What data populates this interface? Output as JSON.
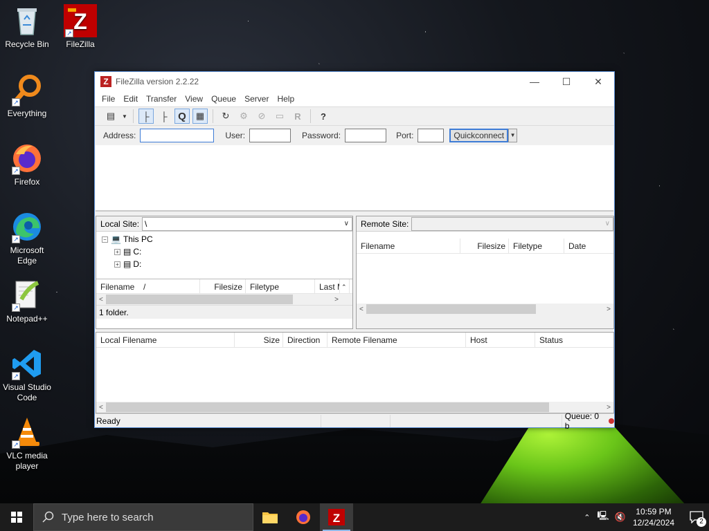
{
  "desktop": {
    "icons": [
      {
        "label": "Recycle Bin"
      },
      {
        "label": "FileZilla"
      },
      {
        "label": "Everything"
      },
      {
        "label": "Firefox"
      },
      {
        "label": "Microsoft Edge"
      },
      {
        "label": "Notepad++"
      },
      {
        "label": "Visual Studio Code"
      },
      {
        "label": "VLC media player"
      }
    ]
  },
  "window": {
    "title": "FileZilla version 2.2.22",
    "menu": [
      "File",
      "Edit",
      "Transfer",
      "View",
      "Queue",
      "Server",
      "Help"
    ],
    "quickconnect": {
      "address_label": "Address:",
      "user_label": "User:",
      "password_label": "Password:",
      "port_label": "Port:",
      "button_label": "Quickconnect",
      "address_value": "",
      "user_value": "",
      "password_value": "",
      "port_value": ""
    },
    "local": {
      "site_label": "Local Site:",
      "path": "\\",
      "tree": [
        {
          "label": "This PC"
        },
        {
          "label": "C:"
        },
        {
          "label": "D:"
        }
      ],
      "columns": [
        "Filename",
        "/",
        "Filesize",
        "Filetype",
        "Last M"
      ],
      "status": "1 folder."
    },
    "remote": {
      "site_label": "Remote Site:",
      "path": "",
      "columns": [
        "Filename",
        "Filesize",
        "Filetype",
        "Date"
      ]
    },
    "queue": {
      "columns": [
        "Local Filename",
        "Size",
        "Direction",
        "Remote Filename",
        "Host",
        "Status"
      ]
    },
    "statusbar": {
      "ready": "Ready",
      "queue": "Queue: 0 b"
    }
  },
  "taskbar": {
    "search_placeholder": "Type here to search",
    "time": "10:59 PM",
    "date": "12/24/2024",
    "notifications": "2"
  }
}
